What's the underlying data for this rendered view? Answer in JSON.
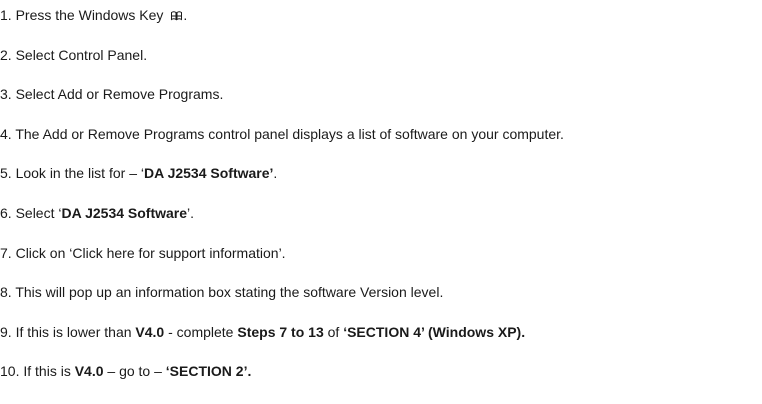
{
  "steps": [
    {
      "num": "1.",
      "parts": [
        {
          "t": " Press the Windows Key "
        }
      ],
      "icon": "windows-key-icon",
      "after": "."
    },
    {
      "num": "2.",
      "parts": [
        {
          "t": " Select Control Panel."
        }
      ]
    },
    {
      "num": "3.",
      "parts": [
        {
          "t": " Select Add or Remove Programs."
        }
      ]
    },
    {
      "num": "4.",
      "parts": [
        {
          "t": " The Add or Remove Programs control panel displays a list of software on your computer."
        }
      ]
    },
    {
      "num": "5.",
      "parts": [
        {
          "t": " Look in the list for – ‘"
        },
        {
          "t": "DA J2534 Software’",
          "b": true
        },
        {
          "t": "."
        }
      ]
    },
    {
      "num": "6.",
      "parts": [
        {
          "t": " Select ‘"
        },
        {
          "t": "DA J2534 Software",
          "b": true
        },
        {
          "t": "’."
        }
      ]
    },
    {
      "num": "7.",
      "parts": [
        {
          "t": " Click on ‘Click here for support information’."
        }
      ]
    },
    {
      "num": "8.",
      "parts": [
        {
          "t": " This will pop up an information box stating the software Version level."
        }
      ]
    },
    {
      "num": "9.",
      "parts": [
        {
          "t": " If this is lower than "
        },
        {
          "t": "V4.0",
          "b": true
        },
        {
          "t": " - complete "
        },
        {
          "t": "Steps 7 to 13",
          "b": true
        },
        {
          "t": " of "
        },
        {
          "t": "‘SECTION 4’ (Windows XP).",
          "b": true
        }
      ]
    },
    {
      "num": "10.",
      "parts": [
        {
          "t": " If this is "
        },
        {
          "t": "V4.0",
          "b": true
        },
        {
          "t": " – go to – "
        },
        {
          "t": "‘SECTION 2’.",
          "b": true
        }
      ]
    }
  ]
}
